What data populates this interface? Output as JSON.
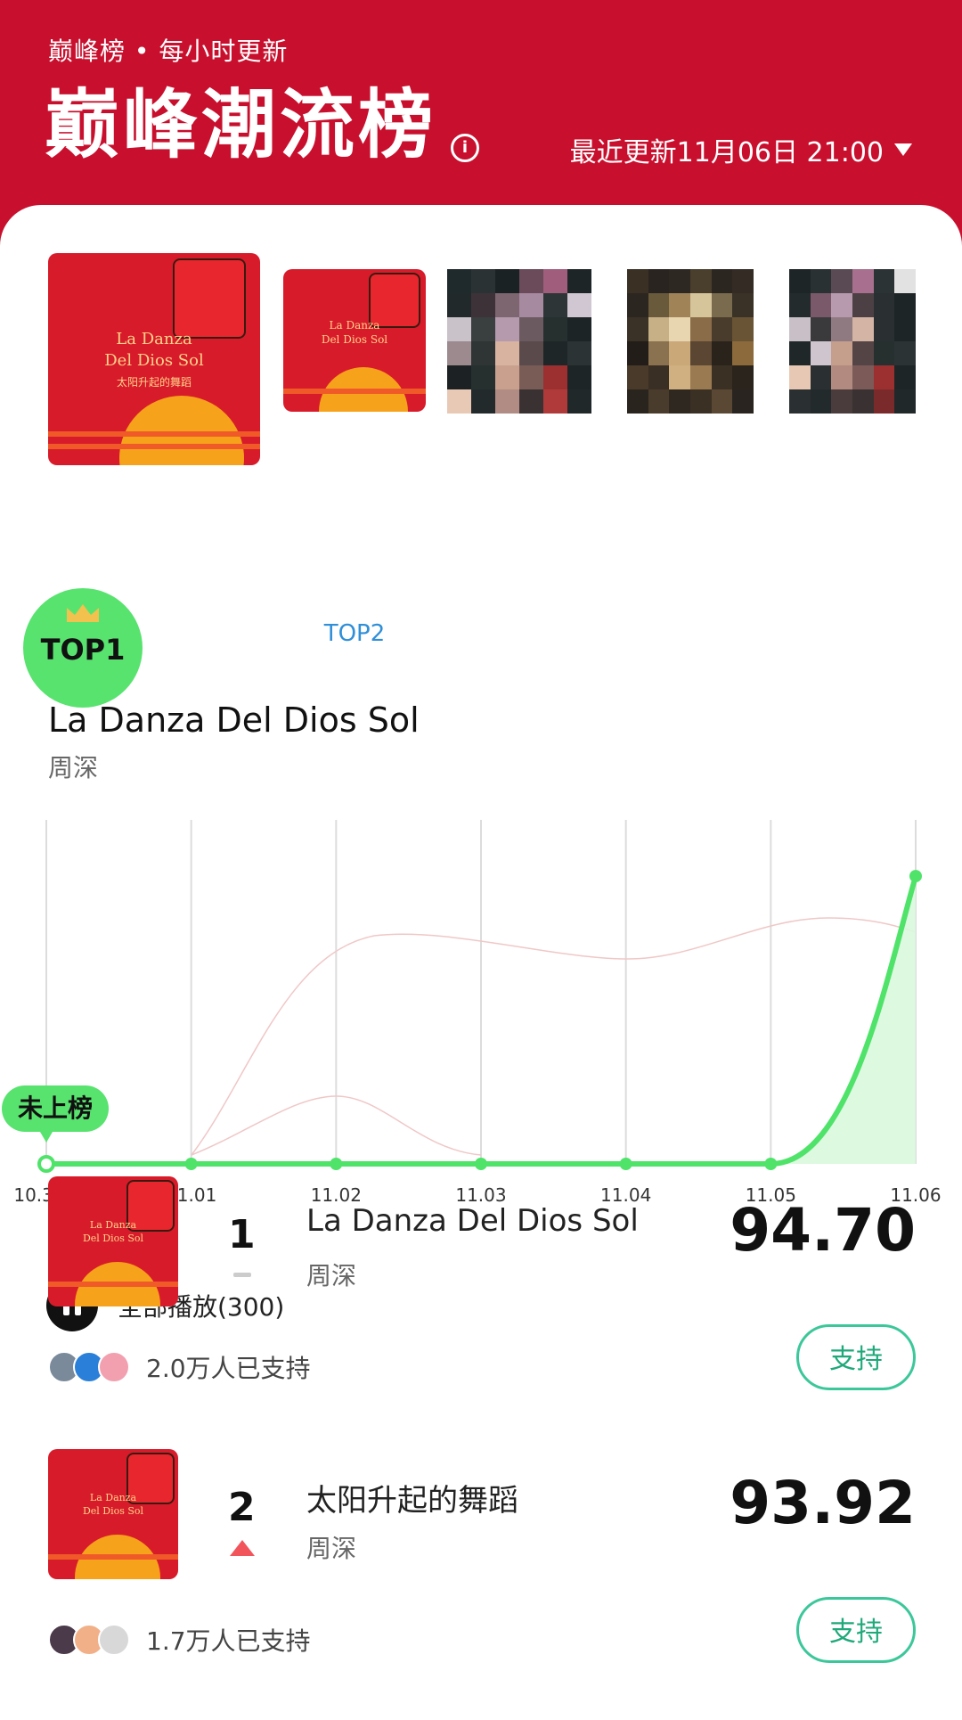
{
  "header": {
    "subtitle": "巅峰榜 • 每小时更新",
    "title": "巅峰潮流榜",
    "update_text": "最近更新11月06日 21:00"
  },
  "featured": {
    "top1_label": "TOP1",
    "top2_label": "TOP2",
    "cover_title_line1": "La Danza",
    "cover_title_line2": "Del Dios Sol",
    "cover_subtitle": "太阳升起的舞蹈",
    "song_title": "La Danza Del Dios Sol",
    "artist": "周深"
  },
  "chart_data": {
    "type": "line",
    "x": [
      "10.31",
      "11.01",
      "11.02",
      "11.03",
      "11.04",
      "11.05",
      "11.06"
    ],
    "series": [
      {
        "values": [
          0,
          0,
          0,
          0,
          0,
          0,
          94.7
        ],
        "color": "#4fe36a"
      }
    ],
    "start_label": "未上榜",
    "ylim": [
      0,
      100
    ],
    "grid": "vertical"
  },
  "playall": {
    "label": "全部播放(300)"
  },
  "list": [
    {
      "rank": "1",
      "trend": "same",
      "name": "La Danza Del Dios Sol",
      "artist": "周深",
      "score": "94.70",
      "supporters": "2.0万人已支持",
      "button": "支持"
    },
    {
      "rank": "2",
      "trend": "up",
      "name": "太阳升起的舞蹈",
      "artist": "周深",
      "score": "93.92",
      "supporters": "1.7万人已支持",
      "button": "支持"
    }
  ],
  "colors": {
    "brand_red": "#c8102e",
    "accent_green": "#4fe36a",
    "support_green": "#3cc79a"
  }
}
